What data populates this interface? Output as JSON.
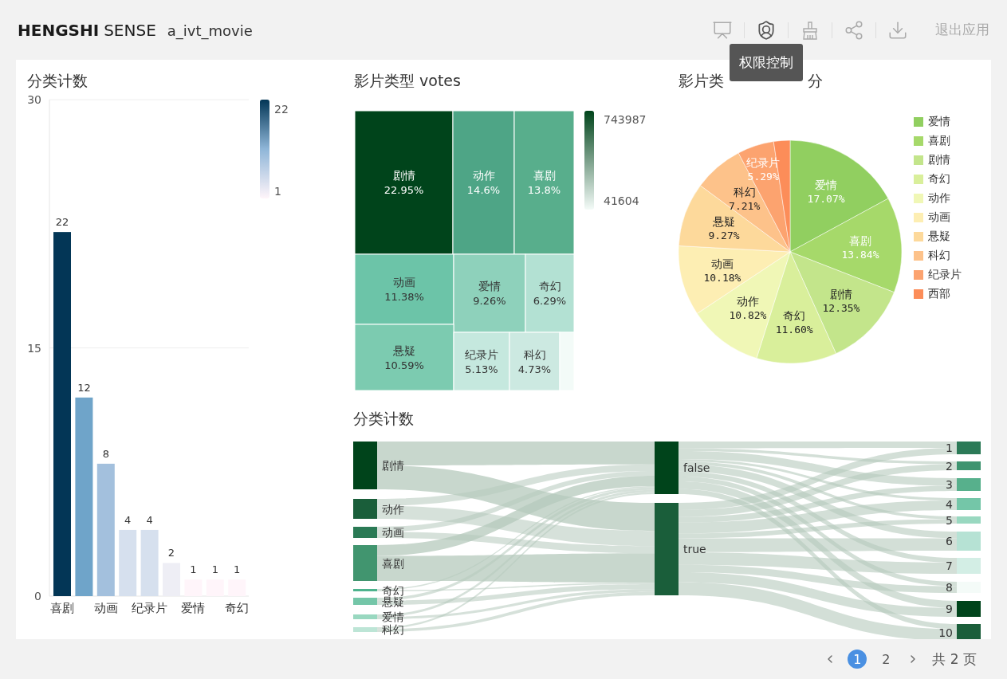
{
  "header": {
    "brand_bold": "HENGSHI",
    "brand_light": "SENSE",
    "app_name": "a_ivt_movie",
    "toolbar": [
      {
        "kind": "present"
      },
      {
        "kind": "permission",
        "tooltip": "权限控制"
      },
      {
        "kind": "clean"
      },
      {
        "kind": "share"
      },
      {
        "kind": "download"
      }
    ],
    "exit_label": "退出应用"
  },
  "bar_panel": {
    "title": "分类计数",
    "legend": {
      "max": "22",
      "min": "1"
    },
    "chart_data": {
      "type": "bar",
      "categories": [
        "喜剧",
        null,
        "动画",
        null,
        "纪录片",
        null,
        "爱情",
        null,
        "奇幻"
      ],
      "values": [
        22,
        12,
        8,
        4,
        4,
        2,
        1,
        1,
        1
      ],
      "ylim": [
        0,
        30
      ],
      "yticks": [
        0,
        15,
        30
      ],
      "data_labels": true
    }
  },
  "treemap_panel": {
    "title": "影片类型 votes",
    "legend": {
      "max": "743987",
      "min": "41604"
    },
    "tiles": [
      {
        "label": "剧情",
        "share": "22.95%",
        "color": "#00441b"
      },
      {
        "label": "动作",
        "share": "14.6%",
        "color": "#4ea586"
      },
      {
        "label": "喜剧",
        "share": "13.8%",
        "color": "#58ae8c"
      },
      {
        "label": "动画",
        "share": "11.38%",
        "color": "#6cc4a8"
      },
      {
        "label": "爱情",
        "share": "9.26%",
        "color": "#8ed1bb"
      },
      {
        "label": "奇幻",
        "share": "6.29%",
        "color": "#b3e1d3"
      },
      {
        "label": "悬疑",
        "share": "10.59%",
        "color": "#7ccbb0"
      },
      {
        "label": "纪录片",
        "share": "5.13%",
        "color": "#c5e8de"
      },
      {
        "label": "科幻",
        "share": "4.73%",
        "color": "#cce9e1"
      },
      {
        "color": "#f3fbf8"
      }
    ]
  },
  "pie_panel": {
    "title_start": "影片类",
    "title_end": "分",
    "chart_data": {
      "type": "pie",
      "categories": [
        "爱情",
        "喜剧",
        "剧情",
        "奇幻",
        "动作",
        "动画",
        "悬疑",
        "科幻",
        "纪录片",
        null
      ],
      "values": [
        17.07,
        13.84,
        12.35,
        11.6,
        10.82,
        10.18,
        9.27,
        7.21,
        5.29,
        2.37
      ],
      "value_labels": [
        "17.07%",
        "13.84%",
        "12.35%",
        "11.60%",
        "10.82%",
        "10.18%",
        "9.27%",
        "7.21%",
        "5.29%",
        null
      ]
    },
    "legend": [
      {
        "label": "爱情",
        "color": "#91cf60"
      },
      {
        "label": "喜剧",
        "color": "#a6d96a"
      },
      {
        "label": "剧情",
        "color": "#c3e58b"
      },
      {
        "label": "奇幻",
        "color": "#d9ef9b"
      },
      {
        "label": "动作",
        "color": "#f0f7b6"
      },
      {
        "label": "动画",
        "color": "#fdeeb3"
      },
      {
        "label": "悬疑",
        "color": "#fdd99b"
      },
      {
        "label": "科幻",
        "color": "#fdc28a"
      },
      {
        "label": "纪录片",
        "color": "#fca36f"
      },
      {
        "label": "西部",
        "color": "#fc8d59"
      }
    ]
  },
  "sankey_panel": {
    "title": "分类计数",
    "sources": [
      {
        "label": "剧情",
        "color": "#00441b"
      },
      {
        "label": "动作",
        "color": "#1a5e3a"
      },
      {
        "label": "动画",
        "color": "#2a7a55"
      },
      {
        "label": "喜剧",
        "color": "#41956f"
      },
      {
        "label": "奇幻",
        "color": "#4db38d"
      },
      {
        "label": "悬疑",
        "color": "#74c6a8"
      },
      {
        "label": "爱情",
        "color": "#99d8c0"
      },
      {
        "label": "科幻",
        "color": "#bde5d6"
      }
    ],
    "middle": [
      {
        "label": "false",
        "color": "#00441b"
      },
      {
        "label": "true",
        "color": "#1a5e3a"
      }
    ],
    "targets": [
      {
        "label": "1",
        "color": "#2b7a57"
      },
      {
        "label": "2",
        "color": "#3e9470"
      },
      {
        "label": "3",
        "color": "#57b08c"
      },
      {
        "label": "4",
        "color": "#74c6a8"
      },
      {
        "label": "5",
        "color": "#99d8c0"
      },
      {
        "label": "6",
        "color": "#b6e2d4"
      },
      {
        "label": "7",
        "color": "#d3eee5"
      },
      {
        "label": "8",
        "color": "#f4fbf8"
      },
      {
        "label": "9",
        "color": "#00441b"
      },
      {
        "label": "10",
        "color": "#1a5e3a"
      }
    ]
  },
  "pagination": {
    "pages": [
      {
        "label": "1",
        "selected": true
      },
      {
        "label": "2",
        "selected": false
      }
    ],
    "total": "共 2 页"
  }
}
